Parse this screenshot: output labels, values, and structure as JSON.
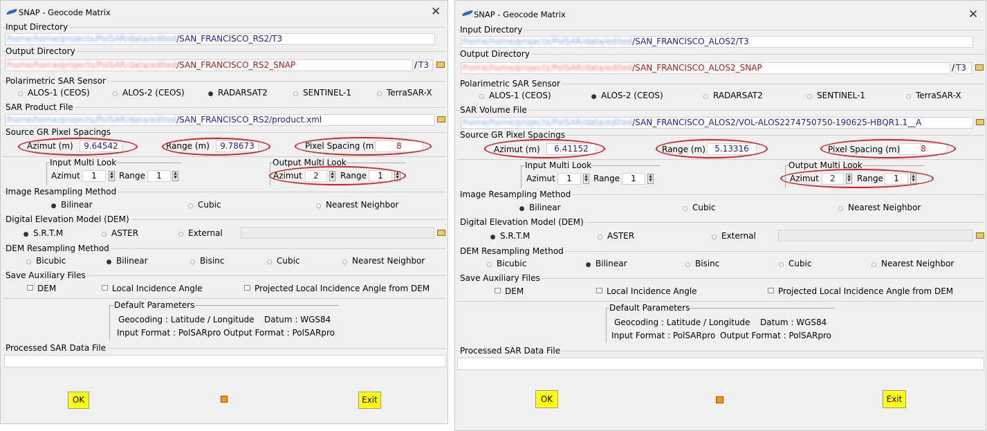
{
  "left": {
    "title": "SNAP - Geocode Matrix",
    "close": "✕",
    "input_dir": {
      "label": "Input Directory",
      "blur": "/home/home/projects/PolSAR/data/edited",
      "value": "/SAN_FRANCISCO_RS2/T3"
    },
    "output_dir": {
      "label": "Output Directory",
      "blur": "/home/home/projects/PolSAR/data/edited",
      "value": "/SAN_FRANCISCO_RS2_SNAP",
      "sep": "/",
      "suffix": "T3"
    },
    "sensor": {
      "label": "Polarimetric SAR Sensor",
      "options": [
        "ALOS-1 (CEOS)",
        "ALOS-2 (CEOS)",
        "RADARSAT2",
        "SENTINEL-1",
        "TerraSAR-X"
      ],
      "selected": 2
    },
    "product": {
      "label": "SAR Product File",
      "blur": "/home/home/projects/PolSAR/data/edited",
      "value": "/SAN_FRANCISCO_RS2/product.xml"
    },
    "spacing": {
      "label": "Source GR Pixel Spacings",
      "azimut_label": "Azimut (m)",
      "azimut": "9.64542",
      "range_label": "Range (m)",
      "range": "9.78673",
      "pixel_label": "Pixel Spacing (m)",
      "pixel": "8"
    },
    "input_ml": {
      "label": "Input Multi Look",
      "azimut_label": "Azimut",
      "azimut": "1",
      "range_label": "Range",
      "range": "1"
    },
    "output_ml": {
      "label": "Output Multi Look",
      "azimut_label": "Azimut",
      "azimut": "2",
      "range_label": "Range",
      "range": "1"
    },
    "resampling": {
      "label": "Image Resampling Method",
      "options": [
        "Bilinear",
        "Cubic",
        "Nearest Neighbor"
      ],
      "selected": 0
    },
    "dem": {
      "label": "Digital Elevation Model (DEM)",
      "options": [
        "S.R.T.M",
        "ASTER",
        "External"
      ],
      "selected": 0
    },
    "dem_resampling": {
      "label": "DEM Resampling Method",
      "options": [
        "Bicubic",
        "Bilinear",
        "Bisinc",
        "Cubic",
        "Nearest Neighbor"
      ],
      "selected": 1
    },
    "aux": {
      "label": "Save Auxiliary Files",
      "options": [
        "DEM",
        "Local Incidence Angle",
        "Projected Local Incidence Angle from DEM"
      ]
    },
    "defaults": {
      "label": "Default Parameters",
      "geocoding": "Geocoding : Latitude / Longitude",
      "datum": "Datum : WGS84",
      "input_format": "Input Format : PolSARpro",
      "output_format": "Output Format : PolSARpro"
    },
    "processed": {
      "label": "Processed SAR Data File",
      "value": ""
    },
    "ok": "OK",
    "exit": "Exit"
  },
  "right": {
    "title": "SNAP - Geocode Matrix",
    "close": "✕",
    "input_dir": {
      "label": "Input Directory",
      "blur": "/home/home/projects/PolSAR/data/edited",
      "value": "/SAN_FRANCISCO_ALOS2/T3"
    },
    "output_dir": {
      "label": "Output Directory",
      "blur": "/home/home/projects/PolSAR/data/edited",
      "value": "/SAN_FRANCISCO_ALOS2_SNAP",
      "sep": "/",
      "suffix": "T3"
    },
    "sensor": {
      "label": "Polarimetric SAR Sensor",
      "options": [
        "ALOS-1 (CEOS)",
        "ALOS-2 (CEOS)",
        "RADARSAT2",
        "SENTINEL-1",
        "TerraSAR-X"
      ],
      "selected": 1
    },
    "product": {
      "label": "SAR Volume File",
      "blur": "/home/home/projects/PolSAR/data/edited",
      "value": "/SAN_FRANCISCO_ALOS2/VOL-ALOS2274750750-190625-HBQR1.1__A"
    },
    "spacing": {
      "label": "Source GR Pixel Spacings",
      "azimut_label": "Azimut (m)",
      "azimut": "6.41152",
      "range_label": "Range (m)",
      "range": "5.13316",
      "pixel_label": "Pixel Spacing (m)",
      "pixel": "8"
    },
    "input_ml": {
      "label": "Input Multi Look",
      "azimut_label": "Azimut",
      "azimut": "1",
      "range_label": "Range",
      "range": "1"
    },
    "output_ml": {
      "label": "Output Multi Look",
      "azimut_label": "Azimut",
      "azimut": "2",
      "range_label": "Range",
      "range": "1"
    },
    "resampling": {
      "label": "Image Resampling Method",
      "options": [
        "Bilinear",
        "Cubic",
        "Nearest Neighbor"
      ],
      "selected": 0
    },
    "dem": {
      "label": "Digital Elevation Model (DEM)",
      "options": [
        "S.R.T.M",
        "ASTER",
        "External"
      ],
      "selected": 0
    },
    "dem_resampling": {
      "label": "DEM Resampling Method",
      "options": [
        "Bicubic",
        "Bilinear",
        "Bisinc",
        "Cubic",
        "Nearest Neighbor"
      ],
      "selected": 1
    },
    "aux": {
      "label": "Save Auxiliary Files",
      "options": [
        "DEM",
        "Local Incidence Angle",
        "Projected Local Incidence Angle from DEM"
      ]
    },
    "defaults": {
      "label": "Default Parameters",
      "geocoding": "Geocoding : Latitude / Longitude",
      "datum": "Datum : WGS84",
      "input_format": "Input Format : PolSARpro",
      "output_format": "Output Format : PolSARpro"
    },
    "processed": {
      "label": "Processed SAR Data File",
      "value": ""
    },
    "ok": "OK",
    "exit": "Exit"
  }
}
